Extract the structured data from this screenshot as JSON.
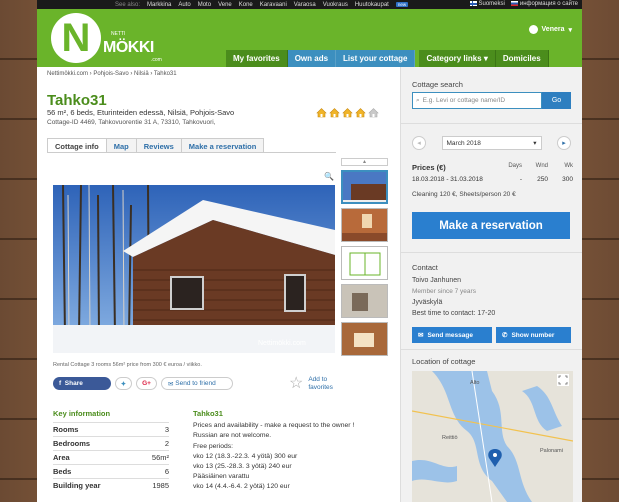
{
  "topbar": {
    "see_also": "See also:",
    "links": [
      "Markkina",
      "Auto",
      "Moto",
      "Vene",
      "Kone",
      "Karavaani",
      "Varaosa",
      "Vuokraus",
      "Huutokaupat"
    ],
    "new_badge": "new",
    "lang_fi": "Suomeksi",
    "lang_ru": "информация о сайте"
  },
  "header": {
    "logo_letter": "N",
    "logo_small": "NETTI",
    "logo_text": "MÖKKI",
    "logo_com": ".com",
    "user_name": "Venera",
    "nav": [
      "My favorites",
      "Own ads",
      "List your cottage",
      "Category links",
      "Domiciles"
    ]
  },
  "breadcrumb": "Nettimökki.com › Pohjois-Savo › Nilsiä › Tahko31",
  "listing": {
    "title": "Tahko31",
    "subtitle": "56 m², 6 beds, Eturinteiden edessä, Nilsiä, Pohjois-Savo",
    "cottage_id": "Cottage-ID 4469, Tahkovuorentie 31 A, 73310, Tahkovuori,",
    "rating": 4,
    "rating_max": 5
  },
  "tabs": [
    "Cottage info",
    "Map",
    "Reviews",
    "Make a reservation"
  ],
  "photo_caption": "Rental Cottage 3 rooms 56m² price from 300 € euroa / viikko.",
  "watermark": "Nettimökki.com",
  "share": {
    "facebook": "Share",
    "google": "G+",
    "send_friend": "Send to friend",
    "add_fav_1": "Add to",
    "add_fav_2": "favorites"
  },
  "key_info": {
    "title": "Key information",
    "rows": [
      {
        "label": "Rooms",
        "value": "3"
      },
      {
        "label": "Bedrooms",
        "value": "2"
      },
      {
        "label": "Area",
        "value": "56m²"
      },
      {
        "label": "Beds",
        "value": "6"
      },
      {
        "label": "Building year",
        "value": "1985"
      }
    ]
  },
  "description": {
    "title": "Tahko31",
    "lines": [
      "Prices and availability - make a request to the owner !",
      "Russian are not welcome.",
      "Free periods:",
      "vko 12 (18.3.-22.3. 4 yötä) 300 eur",
      "vko 13 (25.-28.3. 3 yötä) 240 eur",
      "Pääsiäinen varattu",
      "vko 14 (4.4.-6.4. 2 yötä) 120 eur"
    ]
  },
  "sidebar": {
    "search_label": "Cottage search",
    "search_placeholder": "E.g. Levi or cottage name/ID",
    "search_go": "Go",
    "month": "March 2018",
    "prices_title": "Prices (€)",
    "col_days": "Days",
    "col_wnd": "Wnd",
    "col_wk": "Wk",
    "price_row": {
      "dates": "18.03.2018 - 31.03.2018",
      "days": "-",
      "wnd": "250",
      "wk": "300"
    },
    "cleaning": "Cleaning 120 €, Sheets/person 20 €",
    "reserve": "Make a reservation",
    "contact_title": "Contact",
    "contact_name": "Toivo Janhunen",
    "member_since": "Member since 7 years",
    "city": "Jyväskylä",
    "best_time": "Best time to contact: 17-20",
    "send_message": "Send message",
    "show_number": "Show number",
    "location_title": "Location of cottage",
    "map_labels": [
      "Alto",
      "Reittiö",
      "Palonami"
    ]
  },
  "colors": {
    "brand_green": "#6ab42a",
    "nav_blue": "#3c8fbf",
    "cta_blue": "#2a7fcf",
    "title_green": "#4b8d1c"
  }
}
